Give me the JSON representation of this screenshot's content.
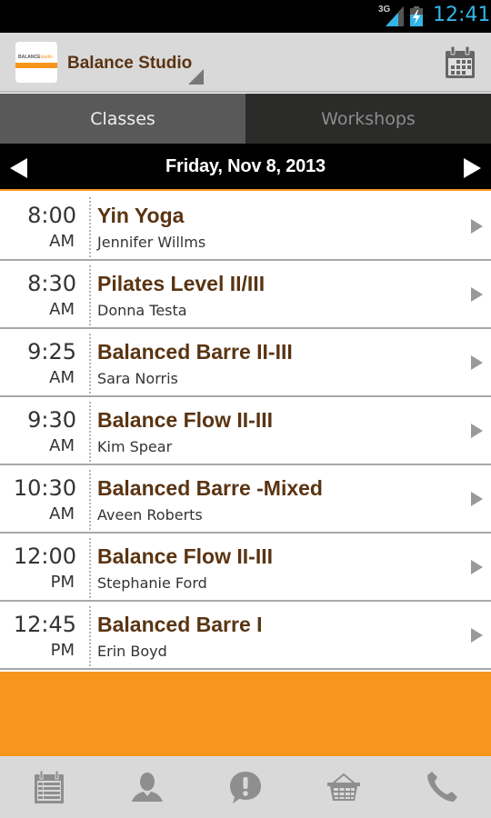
{
  "status_bar": {
    "network": "3G",
    "time": "12:41"
  },
  "action_bar": {
    "logo_text_main": "BALANCE",
    "logo_text_accent": "studio",
    "title": "Balance Studio",
    "calendar_button": "calendar-icon"
  },
  "tabs": [
    {
      "label": "Classes",
      "active": true
    },
    {
      "label": "Workshops",
      "active": false
    }
  ],
  "date_nav": {
    "date": "Friday, Nov 8, 2013"
  },
  "classes": [
    {
      "time": "8:00",
      "ampm": "AM",
      "name": "Yin Yoga",
      "teacher": "Jennifer Willms"
    },
    {
      "time": "8:30",
      "ampm": "AM",
      "name": "Pilates Level II/III",
      "teacher": "Donna Testa"
    },
    {
      "time": "9:25",
      "ampm": "AM",
      "name": "Balanced Barre II-III",
      "teacher": "Sara Norris"
    },
    {
      "time": "9:30",
      "ampm": "AM",
      "name": "Balance Flow II-III",
      "teacher": "Kim Spear"
    },
    {
      "time": "10:30",
      "ampm": "AM",
      "name": "Balanced Barre -Mixed",
      "teacher": "Aveen Roberts"
    },
    {
      "time": "12:00",
      "ampm": "PM",
      "name": "Balance Flow II-III",
      "teacher": "Stephanie Ford"
    },
    {
      "time": "12:45",
      "ampm": "PM",
      "name": "Balanced Barre I",
      "teacher": "Erin Boyd"
    }
  ],
  "bottom_nav": [
    {
      "icon": "schedule-icon"
    },
    {
      "icon": "staff-icon"
    },
    {
      "icon": "alert-icon"
    },
    {
      "icon": "shop-basket-icon"
    },
    {
      "icon": "phone-icon"
    }
  ],
  "colors": {
    "accent_orange": "#f7961c",
    "class_name_brown": "#5a3412",
    "clock_blue": "#33b5e5"
  }
}
